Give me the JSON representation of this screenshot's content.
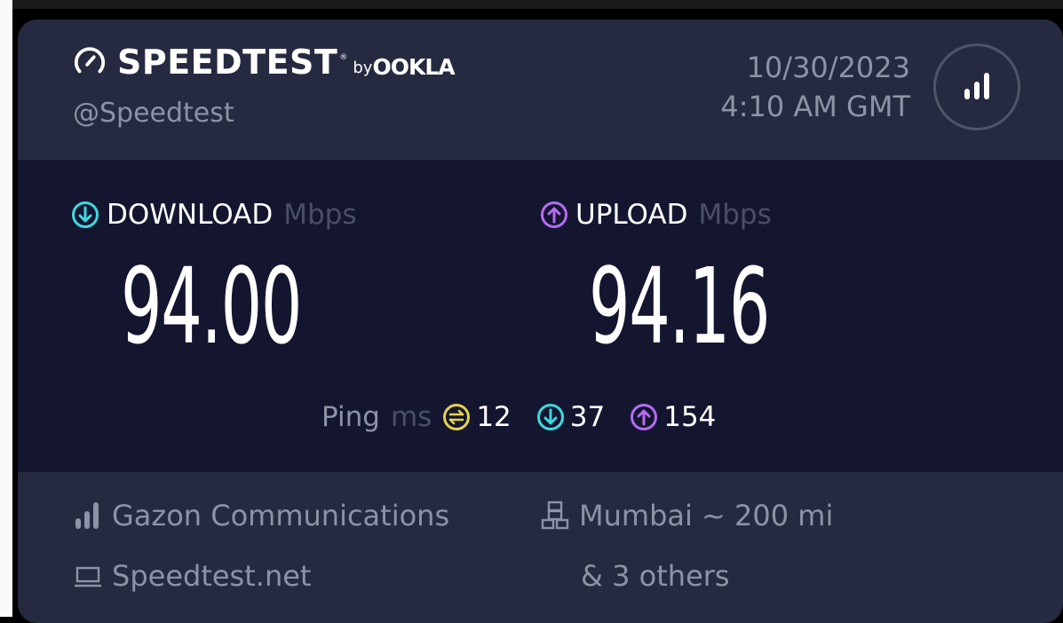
{
  "header": {
    "brand_name": "SPEEDTEST",
    "brand_tm": "®",
    "brand_by": "by",
    "brand_ookla": "OOKLA",
    "handle": "@Speedtest",
    "date": "10/30/2023",
    "time": "4:10 AM GMT",
    "icons": {
      "gauge": "speedometer-icon",
      "signal": "signal-bars-icon"
    }
  },
  "download": {
    "label": "DOWNLOAD",
    "unit": "Mbps",
    "value": "94.00"
  },
  "upload": {
    "label": "UPLOAD",
    "unit": "Mbps",
    "value": "94.16"
  },
  "ping": {
    "label": "Ping",
    "unit": "ms",
    "idle": "12",
    "download": "37",
    "upload": "154"
  },
  "footer": {
    "isp": "Gazon Communications",
    "server": "Mumbai ~ 200 mi",
    "server_extra": "& 3 others",
    "host": "Speedtest.net"
  },
  "colors": {
    "download": "#3ed8e0",
    "upload": "#b46cf0",
    "idle": "#e6d34c",
    "card": "#262a40",
    "panel": "#141630"
  }
}
